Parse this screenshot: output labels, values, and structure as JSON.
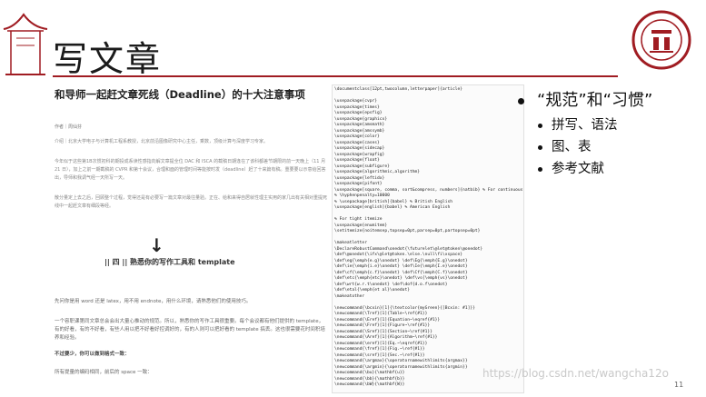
{
  "slide": {
    "title": "写文章",
    "page_number": "11",
    "watermark": "https://blog.csdn.net/wangcha12o",
    "accent_color": "#a01c22"
  },
  "document": {
    "title": "和导师一起赶文章死线（Deadline）的十大注意事项",
    "author": "作者｜周仙芬",
    "intro": "介绍｜北京大学电子与计算机工程系教授，北京前沿图像研究中心主任，乘数，顶级计算与深度学习专家。",
    "para1": "今年似于这些第1B次惯初科的期投成系读性感指向解文章提全位 DAC 和 ISCA 的截稿日期逢在了该科都差节期限的前一天晚上（11 月 21 日），加上之前一期截稿的 CVPR 和第十会议，合理和面的管理时间等能按时发（deadline）赶了十来篇有稿。重要要以示意给回答出，导师和我调气经一天所写一天。",
    "para2": "散分量定上去之后，回顾整个过程，觉得还是有必要写一篇文章对最往量验。正在、给和来得自居就性理主实用的家几出有关相对重提死线中一起赶文章有细段等经。",
    "arrow": "↓",
    "section_heading": "|| 四 ||   熟悉你的写作工具和 template",
    "p3": "先问你是用 word 还是 latex，用不用 endnote，用什么环境，请熟悉他们的使用技巧。",
    "p4": "一个容职课第同文章总会会出大量心推动的规范。所以，熟悉你的写作工具很重要。每个会议都有他们提供的 template，有的好看，有的不好看，有些人用以把不好看好控调好的，有的人则可以把好看的 template 搞丢。这也很需要花时间积培养和经验。",
    "p5": "不过要少，你可以做到格式一致：",
    "p6": "所有提量的编码相同，前后的 space 一致："
  },
  "code_lines": [
    "\\documentclass[12pt,twocolumn,letterpaper]{article}",
    "",
    "\\usepackage{cvpr}",
    "\\usepackage{times}",
    "\\usepackage{epsfig}",
    "\\usepackage{graphicx}",
    "\\usepackage{amsmath}",
    "\\usepackage{amssymb}",
    "\\usepackage{color}",
    "\\usepackage{cases}",
    "\\usepackage{sidecap}",
    "\\usepackage{wrapfig}",
    "\\usepackage{float}",
    "\\usepackage{subfigure}",
    "\\usepackage{algorithmic,algorithm}",
    "\\usepackage{leftidx}",
    "\\usepackage{pifont}",
    "\\usepackage[square, comma, sort&compress, numbers]{natbib} % For continuous reference numbers",
    "% \\hyphenpenalty=10000",
    "% \\usepackage[british]{babel} % British English",
    "\\usepackage[english]{babel} % American English",
    "",
    "% For tight itemize",
    "\\usepackage{enumitem}",
    "\\setitemize{noitemsep,topsep=0pt,parsep=0pt,partopsep=0pt}",
    "",
    "\\makeatletter",
    "\\DeclareRobustCommand\\onedot{\\futurelet\\@let@token\\@onedot}",
    "\\def\\@onedot{\\ifx\\@let@token.\\else.\\null\\fi\\xspace}",
    "\\def\\eg{\\emph{e.g}\\onedot} \\def\\Eg{\\emph{E.g}\\onedot}",
    "\\def\\ie{\\emph{i.e}\\onedot} \\def\\Ie{\\emph{I.e}\\onedot}",
    "\\def\\cf{\\emph{c.f}\\onedot} \\def\\Cf{\\emph{C.f}\\onedot}",
    "\\def\\etc{\\emph{etc}\\onedot} \\def\\vs{\\emph{vs}\\onedot}",
    "\\def\\wrt{w.r.t\\onedot} \\def\\dof{d.o.f\\onedot}",
    "\\def\\etal{\\emph{et al}\\onedot}",
    "\\makeatother",
    "",
    "\\newcommand{\\bcxin}[1]{\\textcolor{myGreen}{[Bcxin: #1]}}",
    "\\newcommand{\\Tref}[1]{Table~\\ref{#1}}",
    "\\newcommand{\\Eref}[1]{Equation~\\eqref{#1}}",
    "\\newcommand{\\Fref}[1]{Figure~\\ref{#1}}",
    "\\newcommand{\\Sref}[1]{Section~\\ref{#1}}",
    "\\newcommand{\\Aref}[1]{Algorithm~\\ref{#1}}",
    "\\newcommand{\\eref}[1]{Eq.~\\eqref{#1}}",
    "\\newcommand{\\fref}[1]{Fig.~\\ref{#1}}",
    "\\newcommand{\\sref}[1]{Sec.~\\ref{#1}}",
    "\\newcommand{\\argmax}{\\operatornamewithlimits{argmax}}",
    "\\newcommand{\\argmin}{\\operatornamewithlimits{argmin}}",
    "\\newcommand{\\bu}{\\mathbf{u}}",
    "\\newcommand{\\bb}{\\mathbf{b}}",
    "\\newcommand{\\bW}{\\mathbf{W}}"
  ],
  "bullets": {
    "main": "“规范”和“习惯”",
    "subs": [
      "拼写、语法",
      "图、表",
      "参考文献"
    ]
  }
}
